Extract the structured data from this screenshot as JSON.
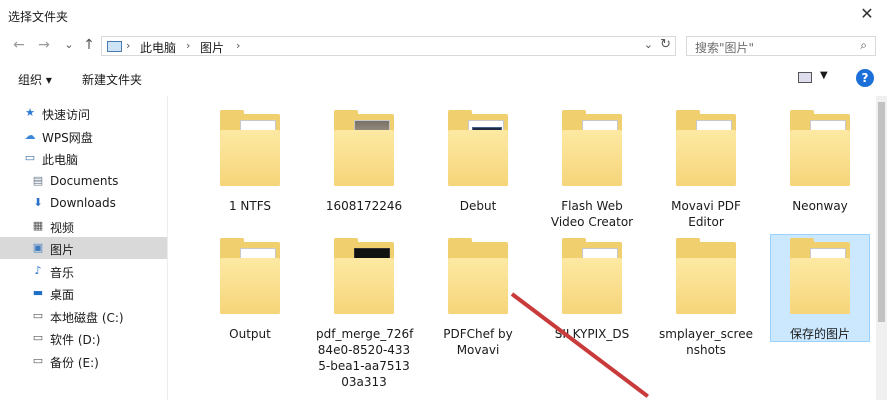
{
  "window": {
    "title": "选择文件夹",
    "close_glyph": "✕"
  },
  "nav": {
    "back_glyph": "←",
    "forward_glyph": "→",
    "recent_glyph": "⌄",
    "up_glyph": "↑",
    "breadcrumb": [
      "此电脑",
      "图片"
    ],
    "breadcrumb_sep": "›",
    "dropdown_glyph": "⌄",
    "refresh_glyph": "↻",
    "search_placeholder": "搜索\"图片\"",
    "search_icon": "⌕"
  },
  "toolbar": {
    "organize_label": "组织 ▾",
    "new_folder_label": "新建文件夹",
    "view_dd_glyph": "▼",
    "help_label": "?"
  },
  "sidebar": {
    "items": [
      {
        "label": "快速访问",
        "icon": "★",
        "color": "#2d7bd6",
        "indent": 1
      },
      {
        "label": "WPS网盘",
        "icon": "☁",
        "color": "#3a86d8",
        "indent": 1
      },
      {
        "label": "此电脑",
        "icon": "▭",
        "color": "#3e6fa8",
        "indent": 1
      },
      {
        "label": "Documents",
        "icon": "▤",
        "color": "#6a7a8a",
        "indent": 2
      },
      {
        "label": "Downloads",
        "icon": "⬇",
        "color": "#2a6fc9",
        "indent": 2
      },
      {
        "label": "视频",
        "icon": "▦",
        "color": "#555",
        "indent": 2
      },
      {
        "label": "图片",
        "icon": "▣",
        "color": "#3f7bbf",
        "indent": 2,
        "selected": true
      },
      {
        "label": "音乐",
        "icon": "♪",
        "color": "#2a6fc9",
        "indent": 2
      },
      {
        "label": "桌面",
        "icon": "▬",
        "color": "#1f6fc9",
        "indent": 2
      },
      {
        "label": "本地磁盘 (C:)",
        "icon": "▭",
        "color": "#555",
        "indent": 2
      },
      {
        "label": "软件 (D:)",
        "icon": "▭",
        "color": "#555",
        "indent": 2
      },
      {
        "label": "备份 (E:)",
        "icon": "▭",
        "color": "#555",
        "indent": 2
      }
    ]
  },
  "folders": [
    {
      "name": "1 NTFS",
      "paper": "doc"
    },
    {
      "name": "1608172246",
      "paper": "img"
    },
    {
      "name": "Debut",
      "paper": "blue"
    },
    {
      "name": "Flash Web\nVideo Creator",
      "paper": "doc"
    },
    {
      "name": "Movavi PDF\nEditor",
      "paper": "doc"
    },
    {
      "name": "Neonway",
      "paper": "doc"
    },
    {
      "name": "Output",
      "paper": "doc"
    },
    {
      "name": "pdf_merge_726f\n84e0-8520-433\n5-bea1-aa7513\n03a313",
      "paper": "dark"
    },
    {
      "name": "PDFChef by\nMovavi",
      "paper": "none"
    },
    {
      "name": "SILKYPIX_DS",
      "paper": "doc"
    },
    {
      "name": "smplayer_scree\nnshots",
      "paper": "none"
    },
    {
      "name": "保存的图片",
      "paper": "red",
      "selected": true
    }
  ]
}
